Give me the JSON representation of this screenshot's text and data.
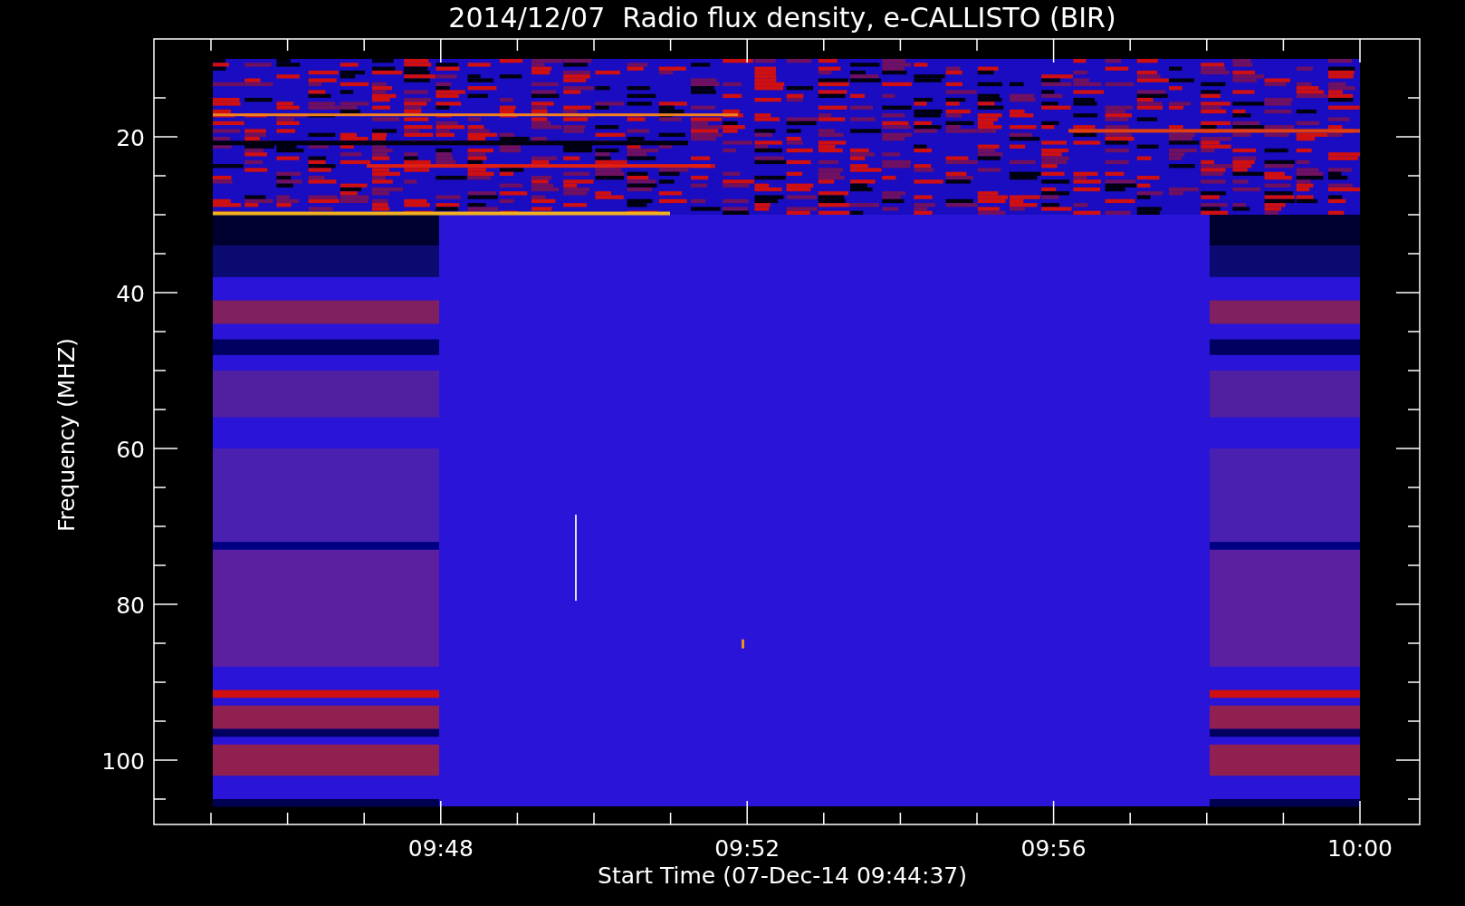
{
  "title": "2014/12/07  Radio flux density, e-CALLISTO (BIR)",
  "y_axis": {
    "label": "Frequency (MHZ)",
    "ticks": [
      "20",
      "40",
      "60",
      "80",
      "100"
    ]
  },
  "x_axis": {
    "label": "Start Time (07-Dec-14 09:44:37)",
    "ticks": [
      "09:48",
      "09:52",
      "09:56",
      "10:00"
    ]
  }
}
